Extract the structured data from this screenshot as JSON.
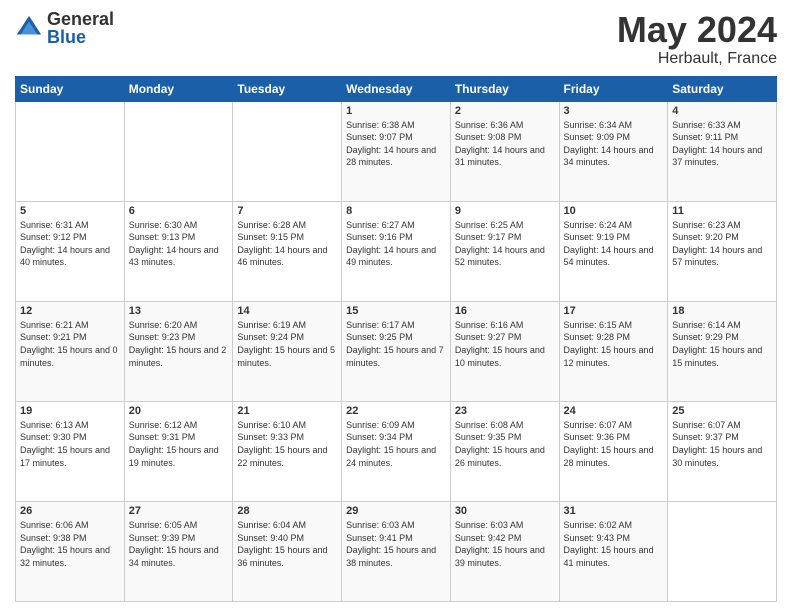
{
  "logo": {
    "general": "General",
    "blue": "Blue"
  },
  "title": {
    "month_year": "May 2024",
    "location": "Herbault, France"
  },
  "days_header": [
    "Sunday",
    "Monday",
    "Tuesday",
    "Wednesday",
    "Thursday",
    "Friday",
    "Saturday"
  ],
  "weeks": [
    [
      {
        "day": "",
        "sunrise": "",
        "sunset": "",
        "daylight": ""
      },
      {
        "day": "",
        "sunrise": "",
        "sunset": "",
        "daylight": ""
      },
      {
        "day": "",
        "sunrise": "",
        "sunset": "",
        "daylight": ""
      },
      {
        "day": "1",
        "sunrise": "Sunrise: 6:38 AM",
        "sunset": "Sunset: 9:07 PM",
        "daylight": "Daylight: 14 hours and 28 minutes."
      },
      {
        "day": "2",
        "sunrise": "Sunrise: 6:36 AM",
        "sunset": "Sunset: 9:08 PM",
        "daylight": "Daylight: 14 hours and 31 minutes."
      },
      {
        "day": "3",
        "sunrise": "Sunrise: 6:34 AM",
        "sunset": "Sunset: 9:09 PM",
        "daylight": "Daylight: 14 hours and 34 minutes."
      },
      {
        "day": "4",
        "sunrise": "Sunrise: 6:33 AM",
        "sunset": "Sunset: 9:11 PM",
        "daylight": "Daylight: 14 hours and 37 minutes."
      }
    ],
    [
      {
        "day": "5",
        "sunrise": "Sunrise: 6:31 AM",
        "sunset": "Sunset: 9:12 PM",
        "daylight": "Daylight: 14 hours and 40 minutes."
      },
      {
        "day": "6",
        "sunrise": "Sunrise: 6:30 AM",
        "sunset": "Sunset: 9:13 PM",
        "daylight": "Daylight: 14 hours and 43 minutes."
      },
      {
        "day": "7",
        "sunrise": "Sunrise: 6:28 AM",
        "sunset": "Sunset: 9:15 PM",
        "daylight": "Daylight: 14 hours and 46 minutes."
      },
      {
        "day": "8",
        "sunrise": "Sunrise: 6:27 AM",
        "sunset": "Sunset: 9:16 PM",
        "daylight": "Daylight: 14 hours and 49 minutes."
      },
      {
        "day": "9",
        "sunrise": "Sunrise: 6:25 AM",
        "sunset": "Sunset: 9:17 PM",
        "daylight": "Daylight: 14 hours and 52 minutes."
      },
      {
        "day": "10",
        "sunrise": "Sunrise: 6:24 AM",
        "sunset": "Sunset: 9:19 PM",
        "daylight": "Daylight: 14 hours and 54 minutes."
      },
      {
        "day": "11",
        "sunrise": "Sunrise: 6:23 AM",
        "sunset": "Sunset: 9:20 PM",
        "daylight": "Daylight: 14 hours and 57 minutes."
      }
    ],
    [
      {
        "day": "12",
        "sunrise": "Sunrise: 6:21 AM",
        "sunset": "Sunset: 9:21 PM",
        "daylight": "Daylight: 15 hours and 0 minutes."
      },
      {
        "day": "13",
        "sunrise": "Sunrise: 6:20 AM",
        "sunset": "Sunset: 9:23 PM",
        "daylight": "Daylight: 15 hours and 2 minutes."
      },
      {
        "day": "14",
        "sunrise": "Sunrise: 6:19 AM",
        "sunset": "Sunset: 9:24 PM",
        "daylight": "Daylight: 15 hours and 5 minutes."
      },
      {
        "day": "15",
        "sunrise": "Sunrise: 6:17 AM",
        "sunset": "Sunset: 9:25 PM",
        "daylight": "Daylight: 15 hours and 7 minutes."
      },
      {
        "day": "16",
        "sunrise": "Sunrise: 6:16 AM",
        "sunset": "Sunset: 9:27 PM",
        "daylight": "Daylight: 15 hours and 10 minutes."
      },
      {
        "day": "17",
        "sunrise": "Sunrise: 6:15 AM",
        "sunset": "Sunset: 9:28 PM",
        "daylight": "Daylight: 15 hours and 12 minutes."
      },
      {
        "day": "18",
        "sunrise": "Sunrise: 6:14 AM",
        "sunset": "Sunset: 9:29 PM",
        "daylight": "Daylight: 15 hours and 15 minutes."
      }
    ],
    [
      {
        "day": "19",
        "sunrise": "Sunrise: 6:13 AM",
        "sunset": "Sunset: 9:30 PM",
        "daylight": "Daylight: 15 hours and 17 minutes."
      },
      {
        "day": "20",
        "sunrise": "Sunrise: 6:12 AM",
        "sunset": "Sunset: 9:31 PM",
        "daylight": "Daylight: 15 hours and 19 minutes."
      },
      {
        "day": "21",
        "sunrise": "Sunrise: 6:10 AM",
        "sunset": "Sunset: 9:33 PM",
        "daylight": "Daylight: 15 hours and 22 minutes."
      },
      {
        "day": "22",
        "sunrise": "Sunrise: 6:09 AM",
        "sunset": "Sunset: 9:34 PM",
        "daylight": "Daylight: 15 hours and 24 minutes."
      },
      {
        "day": "23",
        "sunrise": "Sunrise: 6:08 AM",
        "sunset": "Sunset: 9:35 PM",
        "daylight": "Daylight: 15 hours and 26 minutes."
      },
      {
        "day": "24",
        "sunrise": "Sunrise: 6:07 AM",
        "sunset": "Sunset: 9:36 PM",
        "daylight": "Daylight: 15 hours and 28 minutes."
      },
      {
        "day": "25",
        "sunrise": "Sunrise: 6:07 AM",
        "sunset": "Sunset: 9:37 PM",
        "daylight": "Daylight: 15 hours and 30 minutes."
      }
    ],
    [
      {
        "day": "26",
        "sunrise": "Sunrise: 6:06 AM",
        "sunset": "Sunset: 9:38 PM",
        "daylight": "Daylight: 15 hours and 32 minutes."
      },
      {
        "day": "27",
        "sunrise": "Sunrise: 6:05 AM",
        "sunset": "Sunset: 9:39 PM",
        "daylight": "Daylight: 15 hours and 34 minutes."
      },
      {
        "day": "28",
        "sunrise": "Sunrise: 6:04 AM",
        "sunset": "Sunset: 9:40 PM",
        "daylight": "Daylight: 15 hours and 36 minutes."
      },
      {
        "day": "29",
        "sunrise": "Sunrise: 6:03 AM",
        "sunset": "Sunset: 9:41 PM",
        "daylight": "Daylight: 15 hours and 38 minutes."
      },
      {
        "day": "30",
        "sunrise": "Sunrise: 6:03 AM",
        "sunset": "Sunset: 9:42 PM",
        "daylight": "Daylight: 15 hours and 39 minutes."
      },
      {
        "day": "31",
        "sunrise": "Sunrise: 6:02 AM",
        "sunset": "Sunset: 9:43 PM",
        "daylight": "Daylight: 15 hours and 41 minutes."
      },
      {
        "day": "",
        "sunrise": "",
        "sunset": "",
        "daylight": ""
      }
    ]
  ]
}
